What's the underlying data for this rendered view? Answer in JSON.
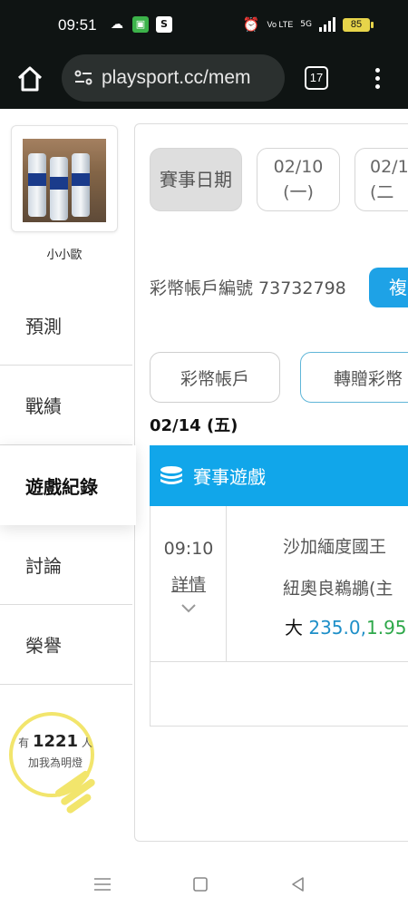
{
  "status_bar": {
    "time": "09:51",
    "volte": "Vo LTE",
    "network": "5G",
    "battery": "85"
  },
  "browser": {
    "url": "playsport.cc/mem",
    "tab_count": "17"
  },
  "sidebar": {
    "username": "小小歐",
    "nav": [
      {
        "label": "預測"
      },
      {
        "label": "戰績"
      },
      {
        "label": "遊戲紀錄",
        "active": true
      },
      {
        "label": "討論"
      },
      {
        "label": "榮譽"
      }
    ],
    "fans": {
      "prefix": "有",
      "count": "1221",
      "suffix": "人",
      "line2": "加我為明燈"
    }
  },
  "main": {
    "date_label": "賽事日期",
    "dates": [
      {
        "date": "02/10",
        "weekday": "(一)"
      },
      {
        "date": "02/1",
        "weekday": "(二"
      }
    ],
    "account_text": "彩幣帳戶編號 73732798",
    "copy_label": "複",
    "tabs": [
      "彩幣帳戶",
      "轉贈彩幣"
    ],
    "section_date": "02/14 (五)",
    "game_section_title": "賽事遊戲",
    "games": [
      {
        "time": "09:10",
        "detail": "詳情",
        "team1": "沙加緬度國王",
        "team2": "紐奧良鵜鶘(主",
        "bet_type": "大",
        "bet_value": "235.0,",
        "bet_odds": "1.95"
      }
    ]
  },
  "colors": {
    "accent_blue": "#11a6ea",
    "copy_button": "#1ea2e6",
    "odds_green": "#2ea84a",
    "fans_yellow": "#f2e56c"
  },
  "icons": [
    "home-icon",
    "site-settings-icon",
    "tabs-icon",
    "more-menu-icon",
    "coin-stack-icon",
    "chevron-down-icon",
    "lightbulb-icon",
    "recents-icon",
    "home-square-icon",
    "back-icon"
  ]
}
